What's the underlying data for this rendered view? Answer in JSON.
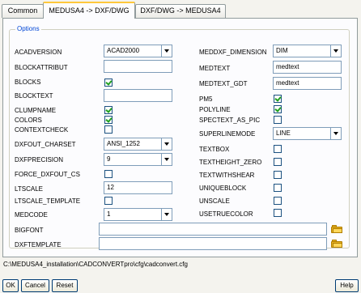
{
  "tabs": [
    {
      "label": "Common"
    },
    {
      "label": "MEDUSA4 -> DXF/DWG"
    },
    {
      "label": "DXF/DWG -> MEDUSA4"
    }
  ],
  "options": {
    "legend": "Options",
    "left": {
      "acadversion": {
        "label": "ACADVERSION",
        "value": "ACAD2000"
      },
      "blockattribut": {
        "label": "BLOCKATTRIBUT",
        "value": ""
      },
      "blocks": {
        "label": "BLOCKS",
        "checked": true
      },
      "blocktext": {
        "label": "BLOCKTEXT",
        "value": ""
      },
      "clumpname": {
        "label": "CLUMPNAME",
        "checked": true
      },
      "colors": {
        "label": "COLORS",
        "checked": true
      },
      "contextcheck": {
        "label": "CONTEXTCHECK",
        "checked": false
      },
      "dxfout_charset": {
        "label": "DXFOUT_CHARSET",
        "value": "ANSI_1252"
      },
      "dxfprecision": {
        "label": "DXFPRECISION",
        "value": "9"
      },
      "force_dxfout_cs": {
        "label": "FORCE_DXFOUT_CS",
        "checked": false
      },
      "ltscale": {
        "label": "LTSCALE",
        "value": "12"
      },
      "ltscale_template": {
        "label": "LTSCALE_TEMPLATE",
        "checked": false
      },
      "medcode": {
        "label": "MEDCODE",
        "value": "1"
      }
    },
    "right": {
      "meddxf_dimension": {
        "label": "MEDDXF_DIMENSION",
        "value": "DIM"
      },
      "medtext": {
        "label": "MEDTEXT",
        "value": "medtext"
      },
      "medtext_gdt": {
        "label": "MEDTEXT_GDT",
        "value": "medtext"
      },
      "pm5": {
        "label": "PM5",
        "checked": true
      },
      "polyline": {
        "label": "POLYLINE",
        "checked": true
      },
      "spectext_as_pic": {
        "label": "SPECTEXT_AS_PIC",
        "checked": false
      },
      "superlinemode": {
        "label": "SUPERLINEMODE",
        "value": "LINE"
      },
      "textbox": {
        "label": "TEXTBOX",
        "checked": false
      },
      "textheight_zero": {
        "label": "TEXTHEIGHT_ZERO",
        "checked": false
      },
      "textwithshear": {
        "label": "TEXTWITHSHEAR",
        "checked": false
      },
      "uniqueblock": {
        "label": "UNIQUEBLOCK",
        "checked": false
      },
      "unscale": {
        "label": "UNSCALE",
        "checked": false
      },
      "usetruecolor": {
        "label": "USETRUECOLOR",
        "checked": false
      }
    },
    "bigfont": {
      "label": "BIGFONT",
      "value": ""
    },
    "dxftemplate": {
      "label": "DXFTEMPLATE",
      "value": ""
    }
  },
  "config_path": "C:\\MEDUSA4_installation\\CADCONVERTpro\\cfg\\cadconvert.cfg",
  "buttons": {
    "ok": "OK",
    "cancel": "Cancel",
    "reset": "Reset",
    "help": "Help"
  },
  "colors": {
    "accent_tab": "#ffc83c",
    "legend": "#0046d5",
    "checkmark": "#21a121",
    "folder": "#e8b320"
  }
}
